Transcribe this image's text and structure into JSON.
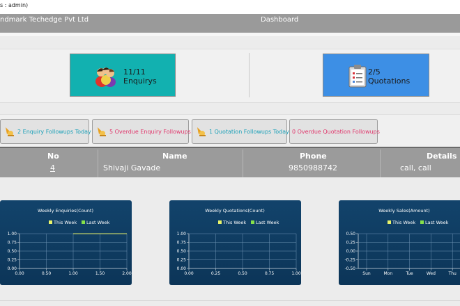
{
  "userbar": {
    "text": "s : admin)"
  },
  "header": {
    "company": "ndmark Techedge Pvt Ltd",
    "section": "Dashboard"
  },
  "cards": [
    {
      "count": "11/11",
      "label": "Enquirys",
      "icon": "people-icon",
      "color": "#12b1b0"
    },
    {
      "count": "2/5",
      "label": "Quotations",
      "icon": "clipboard-icon",
      "color": "#3d8fe5"
    }
  ],
  "followups": [
    {
      "label": "2 Enquiry Followups Today",
      "color": "#1aa0b8"
    },
    {
      "label": "5 Overdue Enquiry Followups",
      "color": "#e0346a"
    },
    {
      "label": "1 Quotation Followups Today",
      "color": "#1aa0b8"
    },
    {
      "label": "0 Overdue Quotation Followups",
      "color": "#e0346a"
    }
  ],
  "table": {
    "headers": {
      "no": "No",
      "name": "Name",
      "phone": "Phone",
      "details": "Details"
    },
    "rows": [
      {
        "no": "4",
        "name": "Shivaji Gavade",
        "phone": "9850988742",
        "details": "call, call"
      }
    ]
  },
  "chart_data": [
    {
      "type": "line",
      "title": "Weekly Enquiries(Count)",
      "legend": [
        "This Week",
        "Last Week"
      ],
      "legend_colors": [
        "#e9f36a",
        "#86e04a"
      ],
      "xticks": [
        "0.00",
        "0.50",
        "1.00",
        "1.50",
        "2.00"
      ],
      "yticks": [
        "0.00",
        "0.25",
        "0.50",
        "0.75",
        "1.00"
      ],
      "xlim": [
        0,
        2
      ],
      "ylim": [
        0,
        1
      ],
      "series": [
        {
          "name": "This Week",
          "x": [
            1,
            2
          ],
          "y": [
            1,
            1
          ]
        }
      ]
    },
    {
      "type": "line",
      "title": "Weekly Quotations(Count)",
      "legend": [
        "This Week",
        "Last Week"
      ],
      "legend_colors": [
        "#e9f36a",
        "#86e04a"
      ],
      "xticks": [
        "0.00",
        "0.25",
        "0.50",
        "0.75",
        "1.00"
      ],
      "yticks": [
        "0.00",
        "0.25",
        "0.50",
        "0.75",
        "1.00"
      ],
      "xlim": [
        0,
        1
      ],
      "ylim": [
        0,
        1
      ],
      "series": []
    },
    {
      "type": "line",
      "title": "Weekly Sales(Amount)",
      "legend": [
        "This Week",
        "Last Week"
      ],
      "legend_colors": [
        "#e9f36a",
        "#86e04a"
      ],
      "xticks": [
        "Sun",
        "Mon",
        "Tue",
        "Wed",
        "Thu"
      ],
      "yticks": [
        "-0.50",
        "-0.25",
        "0.00",
        "0.25",
        "0.50"
      ],
      "xlim": [
        0,
        6
      ],
      "ylim": [
        -0.5,
        0.5
      ],
      "series": []
    }
  ]
}
